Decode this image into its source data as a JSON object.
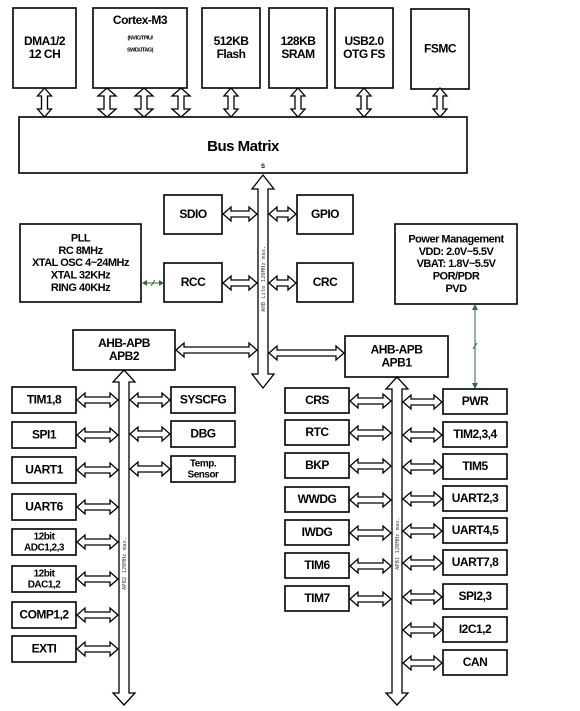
{
  "top_blocks": [
    {
      "id": "dma",
      "lines": [
        "DMA1/2",
        "12 CH"
      ],
      "port": "M"
    },
    {
      "id": "cortex",
      "lines": [
        "Cortex-M3"
      ],
      "sub": [
        "(NVIC/TPIU/",
        "SWD/JTAG)"
      ],
      "ports": [
        "M",
        "M",
        "M"
      ]
    },
    {
      "id": "flash",
      "lines": [
        "512KB",
        "Flash"
      ],
      "port": "S"
    },
    {
      "id": "sram",
      "lines": [
        "128KB",
        "SRAM"
      ],
      "port": "S"
    },
    {
      "id": "usb",
      "lines": [
        "USB2.0",
        "OTG FS"
      ],
      "port": "M"
    },
    {
      "id": "fsmc",
      "lines": [
        "FSMC"
      ],
      "port": "S"
    }
  ],
  "bus_matrix": {
    "label": "Bus Matrix",
    "port": "S"
  },
  "ahb_bus_label": "AHB Lite 120MHz max.",
  "ahb_blocks": [
    {
      "id": "sdio",
      "lines": [
        "SDIO"
      ]
    },
    {
      "id": "gpio",
      "lines": [
        "GPIO"
      ]
    },
    {
      "id": "rcc",
      "lines": [
        "RCC"
      ]
    },
    {
      "id": "crc",
      "lines": [
        "CRC"
      ]
    },
    {
      "id": "pll",
      "lines": [
        "PLL",
        "RC 8MHz",
        "XTAL OSC 4~24MHz",
        "XTAL 32KHz",
        "RING 40KHz"
      ]
    },
    {
      "id": "power",
      "lines": [
        "Power Management",
        "VDD: 2.0V~5.5V",
        "VBAT: 1.8V~5.5V",
        "POR/PDR",
        "PVD"
      ]
    },
    {
      "id": "apb2bridge",
      "lines": [
        "AHB-APB",
        "APB2"
      ]
    },
    {
      "id": "apb1bridge",
      "lines": [
        "AHB-APB",
        "APB1"
      ]
    }
  ],
  "apb2": {
    "bus_label": "APB2 120MHz max.",
    "left": [
      [
        "TIM1,8"
      ],
      [
        "SPI1"
      ],
      [
        "UART1"
      ],
      [
        "UART6"
      ],
      [
        "12bit",
        "ADC1,2,3"
      ],
      [
        "12bit",
        "DAC1,2"
      ],
      [
        "COMP1,2"
      ],
      [
        "EXTI"
      ]
    ],
    "right": [
      [
        "SYSCFG"
      ],
      [
        "DBG"
      ],
      [
        "Temp.",
        "Sensor"
      ]
    ]
  },
  "apb1": {
    "bus_label": "APB1 120MHz max.",
    "left": [
      [
        "CRS"
      ],
      [
        "RTC"
      ],
      [
        "BKP"
      ],
      [
        "WWDG"
      ],
      [
        "IWDG"
      ],
      [
        "TIM6"
      ],
      [
        "TIM7"
      ]
    ],
    "right": [
      [
        "PWR"
      ],
      [
        "TIM2,3,4"
      ],
      [
        "TIM5"
      ],
      [
        "UART2,3"
      ],
      [
        "UART4,5"
      ],
      [
        "UART7,8"
      ],
      [
        "SPI2,3"
      ],
      [
        "I2C1,2"
      ],
      [
        "CAN"
      ]
    ]
  },
  "colors": {
    "line": "#000000",
    "clock_power_link": "#2e6b3a"
  }
}
